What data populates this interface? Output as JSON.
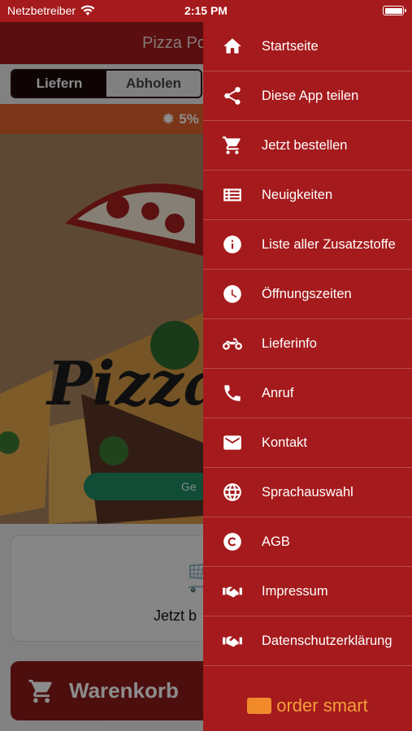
{
  "status_bar": {
    "carrier": "Netzbetreiber",
    "time": "2:15 PM"
  },
  "app": {
    "title": "Pizza Po",
    "tabs": [
      "Liefern",
      "Abholen"
    ],
    "promo_text": "5%",
    "hero_text": "Pizza",
    "pill_text": "Ge",
    "order_label": "Jetzt b",
    "cart_button": "Warenkorb"
  },
  "drawer": {
    "items": [
      {
        "label": "Startseite",
        "icon": "home-icon"
      },
      {
        "label": "Diese App teilen",
        "icon": "share-icon"
      },
      {
        "label": "Jetzt bestellen",
        "icon": "cart-icon"
      },
      {
        "label": "Neuigkeiten",
        "icon": "news-icon"
      },
      {
        "label": "Liste aller Zusatzstoffe",
        "icon": "info-icon"
      },
      {
        "label": "Öffnungszeiten",
        "icon": "clock-icon"
      },
      {
        "label": "Lieferinfo",
        "icon": "motorbike-icon"
      },
      {
        "label": "Anruf",
        "icon": "phone-icon"
      },
      {
        "label": "Kontakt",
        "icon": "mail-icon"
      },
      {
        "label": "Sprachauswahl",
        "icon": "globe-icon"
      },
      {
        "label": "AGB",
        "icon": "copyright-icon"
      },
      {
        "label": "Impressum",
        "icon": "handshake-icon"
      },
      {
        "label": "Datenschutzerklärung",
        "icon": "handshake-icon"
      }
    ],
    "brand": "order smart"
  },
  "colors": {
    "primary": "#a51a1c",
    "accent": "#e0622c",
    "brand": "#f3a03a",
    "pill": "#1f8a63"
  }
}
